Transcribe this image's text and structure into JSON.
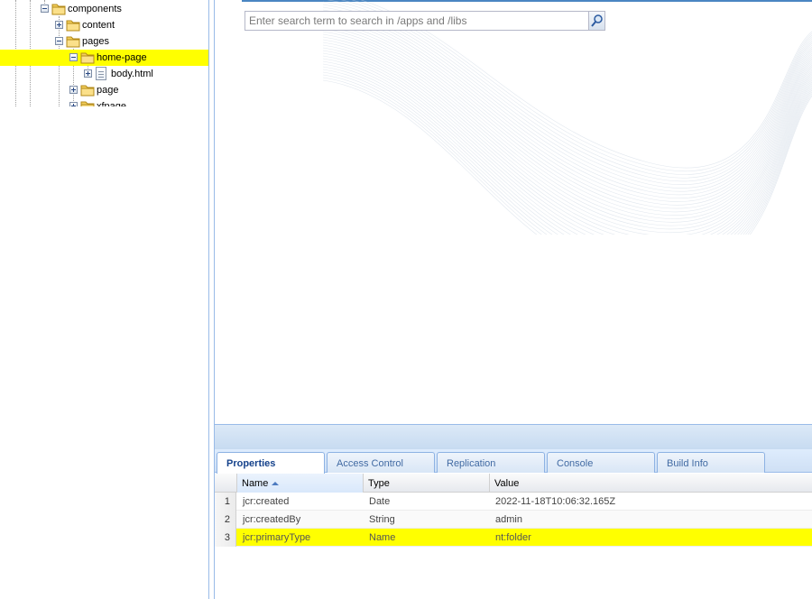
{
  "tree": {
    "nodes": [
      {
        "label": "components",
        "toggle": "minus",
        "icon": "folder-icon"
      },
      {
        "label": "content",
        "toggle": "plus",
        "icon": "folder-icon"
      },
      {
        "label": "pages",
        "toggle": "minus",
        "icon": "folder-icon"
      },
      {
        "label": "home-page",
        "toggle": "minus",
        "icon": "folder-icon",
        "selected": true
      },
      {
        "label": "body.html",
        "toggle": "plus",
        "icon": "file-icon"
      },
      {
        "label": "page",
        "toggle": "plus",
        "icon": "folder-icon"
      },
      {
        "label": "xfpage",
        "toggle": "plus",
        "icon": "folder-icon"
      }
    ]
  },
  "search": {
    "placeholder": "Enter search term to search in /apps and /libs",
    "button_icon": "magnifier-icon"
  },
  "tabs": [
    {
      "label": "Properties",
      "active": true
    },
    {
      "label": "Access Control"
    },
    {
      "label": "Replication"
    },
    {
      "label": "Console"
    },
    {
      "label": "Build Info"
    }
  ],
  "grid": {
    "columns": [
      "Name",
      "Type",
      "Value"
    ],
    "sorted_column": "Name",
    "rows": [
      {
        "num": "1",
        "name": "jcr:created",
        "type": "Date",
        "value": "2022-11-18T10:06:32.165Z"
      },
      {
        "num": "2",
        "name": "jcr:createdBy",
        "type": "String",
        "value": "admin"
      },
      {
        "num": "3",
        "name": "jcr:primaryType",
        "type": "Name",
        "value": "nt:folder",
        "selected": true
      }
    ]
  },
  "colors": {
    "selection": "#ffff00",
    "accent": "#4a86c2",
    "tab_text": "#15428b",
    "border": "#99bbe8"
  }
}
